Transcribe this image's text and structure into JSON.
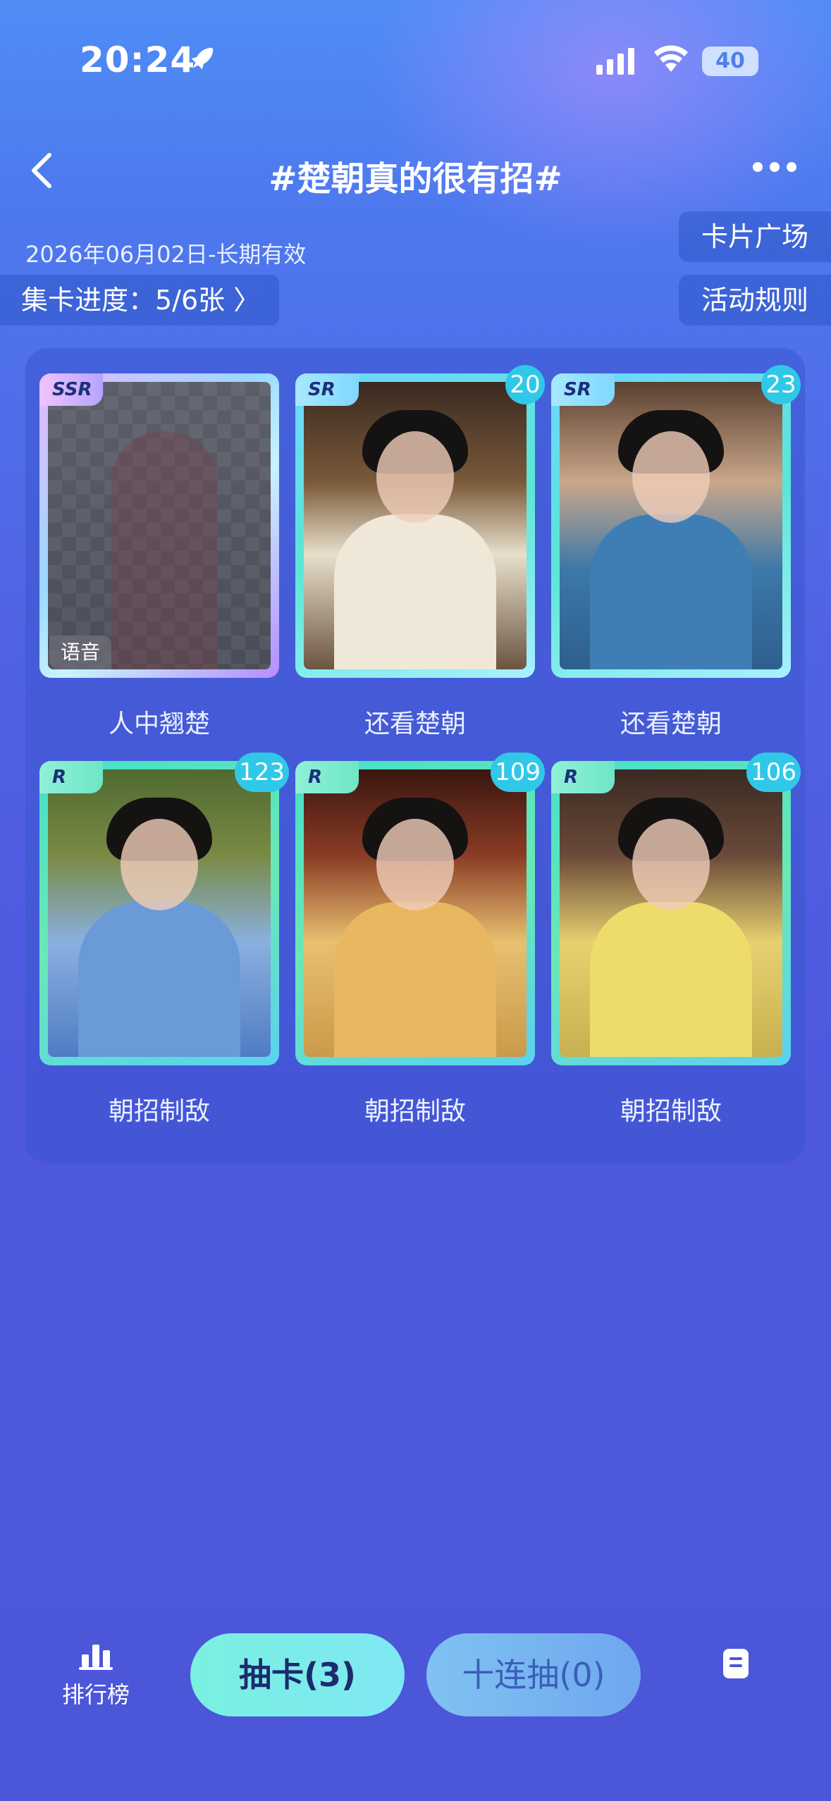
{
  "status_bar": {
    "time": "20:24",
    "battery": "40"
  },
  "header": {
    "title": "#楚朝真的很有招#"
  },
  "info": {
    "date_range": "2026年06月02日-长期有效",
    "progress": "集卡进度：5/6张 〉"
  },
  "side_buttons": {
    "card_square": "卡片广场",
    "rules": "活动规则"
  },
  "cards": [
    {
      "rarity": "SSR",
      "name": "人中翘楚",
      "count": "",
      "tag": "语音",
      "owned": false
    },
    {
      "rarity": "SR",
      "name": "还看楚朝",
      "count": "20",
      "owned": true
    },
    {
      "rarity": "SR",
      "name": "还看楚朝",
      "count": "23",
      "owned": true
    },
    {
      "rarity": "R",
      "name": "朝招制敌",
      "count": "123",
      "owned": true
    },
    {
      "rarity": "R",
      "name": "朝招制敌",
      "count": "109",
      "owned": true
    },
    {
      "rarity": "R",
      "name": "朝招制敌",
      "count": "106",
      "owned": true
    }
  ],
  "bottom_bar": {
    "leaderboard": "排行榜",
    "draw": "抽卡(3)",
    "draw_ten": "十连抽(0)"
  },
  "icons": {
    "rocket": "rocket-icon",
    "signal": "signal-icon",
    "wifi": "wifi-icon",
    "back": "back-arrow-icon",
    "more": "more-dots-icon",
    "rank": "bar-chart-icon",
    "doc": "document-icon"
  }
}
